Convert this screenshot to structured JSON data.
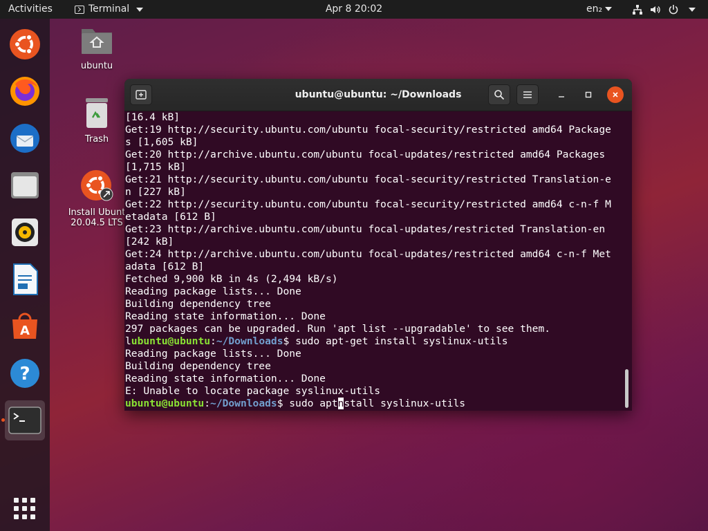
{
  "topbar": {
    "activities": "Activities",
    "app_name": "Terminal",
    "clock": "Apr 8  20:02",
    "lang": "en₂",
    "status_icons": [
      "network-icon",
      "volume-icon",
      "power-icon",
      "chevron-down-icon"
    ]
  },
  "dock": {
    "items": [
      {
        "name": "Install Ubuntu",
        "icon": "ubuntu-installer-icon"
      },
      {
        "name": "Firefox",
        "icon": "firefox-icon"
      },
      {
        "name": "Thunderbird",
        "icon": "thunderbird-icon"
      },
      {
        "name": "Files",
        "icon": "files-icon"
      },
      {
        "name": "Rhythmbox",
        "icon": "rhythmbox-icon"
      },
      {
        "name": "LibreOffice Writer",
        "icon": "writer-icon"
      },
      {
        "name": "Ubuntu Software",
        "icon": "software-icon"
      },
      {
        "name": "Help",
        "icon": "help-icon"
      },
      {
        "name": "Terminal",
        "icon": "terminal-icon",
        "active": true
      },
      {
        "name": "Show Applications",
        "icon": "app-grid-icon"
      }
    ]
  },
  "desktop": {
    "home_label": "ubuntu",
    "trash_label": "Trash",
    "installer_label_1": "Install Ubunt",
    "installer_label_2": "20.04.5 LTS"
  },
  "window": {
    "title": "ubuntu@ubuntu: ~/Downloads",
    "new_tab_icon": "new-tab-icon",
    "search_icon": "search-icon",
    "menu_icon": "hamburger-menu-icon"
  },
  "terminal": {
    "lines": [
      "[16.4 kB]",
      "Get:19 http://security.ubuntu.com/ubuntu focal-security/restricted amd64 Package",
      "s [1,605 kB]",
      "Get:20 http://archive.ubuntu.com/ubuntu focal-updates/restricted amd64 Packages",
      "[1,715 kB]",
      "Get:21 http://security.ubuntu.com/ubuntu focal-security/restricted Translation-e",
      "n [227 kB]",
      "Get:22 http://security.ubuntu.com/ubuntu focal-security/restricted amd64 c-n-f M",
      "etadata [612 B]",
      "Get:23 http://archive.ubuntu.com/ubuntu focal-updates/restricted Translation-en",
      "[242 kB]",
      "Get:24 http://archive.ubuntu.com/ubuntu focal-updates/restricted amd64 c-n-f Met",
      "adata [612 B]",
      "Fetched 9,900 kB in 4s (2,494 kB/s)",
      "Reading package lists... Done",
      "Building dependency tree",
      "Reading state information... Done",
      "297 packages can be upgraded. Run 'apt list --upgradable' to see them."
    ],
    "cmd1_prefix": "l",
    "prompt_user": "ubuntu@ubuntu",
    "prompt_colon": ":",
    "prompt_path": "~/Downloads",
    "prompt_dollar": "$ ",
    "cmd1": "sudo apt-get install syslinux-utils",
    "lines_after": [
      "Reading package lists... Done",
      "Building dependency tree",
      "Reading state information... Done",
      "E: Unable to locate package syslinux-utils"
    ],
    "cmd2_before": "sudo apt",
    "cmd2_cursor": "n",
    "cmd2_after": "stall syslinux-utils"
  },
  "colors": {
    "terminal_bg": "#300a24",
    "prompt_user": "#8ae234",
    "prompt_path": "#729fcf",
    "accent": "#e95420"
  }
}
